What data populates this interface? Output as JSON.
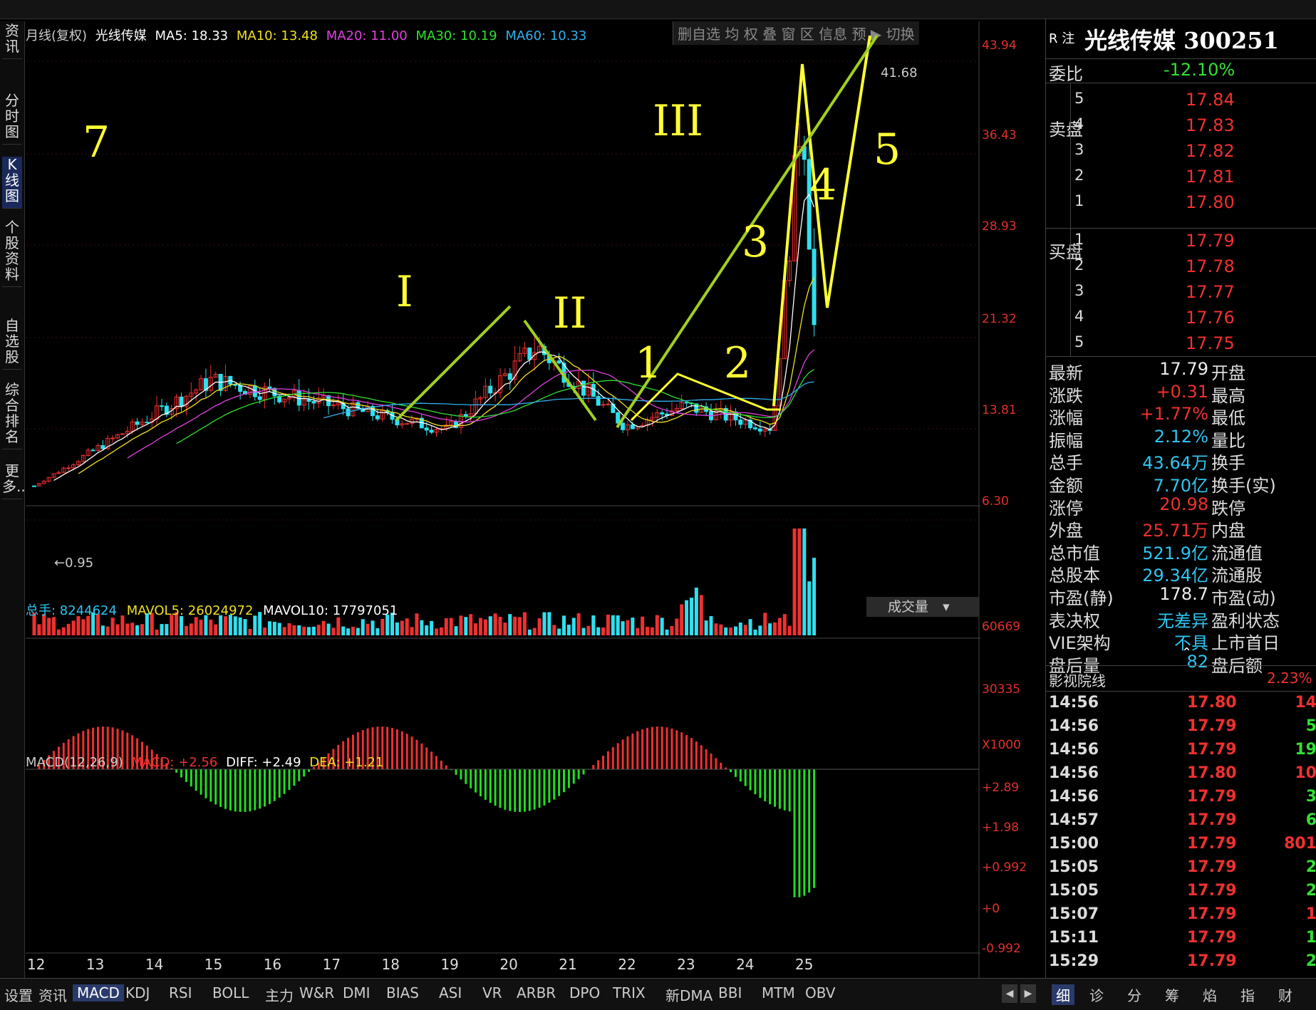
{
  "top_menu": [],
  "left_nav": [
    {
      "label": "资讯",
      "active": false
    },
    {
      "label": "分时图",
      "active": false
    },
    {
      "label": "K线图",
      "active": true
    },
    {
      "label": "个股资料",
      "active": false
    },
    {
      "label": "自选股",
      "active": false
    },
    {
      "label": "综合排名",
      "active": false
    },
    {
      "label": "更多..",
      "active": false
    }
  ],
  "chart_header": {
    "period": "月线(复权)",
    "stock_name": "光线传媒",
    "ma5": "MA5: 18.33",
    "ma10": "MA10: 13.48",
    "ma20": "MA20: 11.00",
    "ma30": "MA30: 10.19",
    "ma60": "MA60: 10.33",
    "tools": [
      "删自选",
      "均",
      "权",
      "叠",
      "窗",
      "区",
      "信息",
      "预",
      "切换"
    ]
  },
  "price_axis": [
    "43.94",
    "36.43",
    "28.93",
    "21.32",
    "13.81",
    "6.30"
  ],
  "price_annotations": {
    "high_label": "41.68",
    "low_label": "0.95"
  },
  "volume_header": {
    "total": "总手: 8244624",
    "mavol5": "MAVOL5: 26024972",
    "mavol10": "MAVOL10: 17797051",
    "selector": "成交量"
  },
  "volume_axis": [
    "60669",
    "30335",
    "X1000"
  ],
  "macd_header": {
    "name": "MACD(12,26,9)",
    "macd": "MACD: +2.56",
    "diff": "DIFF: +2.49",
    "dea": "DEA: +1.21"
  },
  "macd_axis": [
    "+2.89",
    "+1.98",
    "+0.992",
    "+0",
    "-0.992"
  ],
  "x_axis_labels": [
    "12",
    "13",
    "14",
    "15",
    "16",
    "17",
    "18",
    "19",
    "20",
    "21",
    "22",
    "23",
    "24",
    "25"
  ],
  "handwritten_marks": [
    "7",
    "I",
    "II",
    "III",
    "1",
    "2",
    "3",
    "4",
    "5"
  ],
  "chart_data": {
    "type": "candlestick",
    "ylim": [
      0,
      45
    ],
    "key_points": [
      {
        "x": "12",
        "close": 0.95
      },
      {
        "x": "15",
        "close": 12.0
      },
      {
        "x": "19",
        "close": 6.8
      },
      {
        "x": "20.5",
        "close": 15.5
      },
      {
        "x": "22",
        "close": 7.2
      },
      {
        "x": "23",
        "close": 9.3
      },
      {
        "x": "24.5",
        "close": 7.0
      },
      {
        "x": "25",
        "close": 41.68
      },
      {
        "x": "25.2",
        "close": 17.79
      }
    ]
  },
  "quote_panel": {
    "badge": "R 注",
    "title": "光线传媒 300251",
    "webi_label": "委比",
    "webi_value": "-12.10%",
    "sell_label": "卖盘",
    "buy_label": "买盘",
    "sell_levels": [
      {
        "n": "5",
        "price": "17.84"
      },
      {
        "n": "4",
        "price": "17.83"
      },
      {
        "n": "3",
        "price": "17.82"
      },
      {
        "n": "2",
        "price": "17.81"
      },
      {
        "n": "1",
        "price": "17.80"
      }
    ],
    "buy_levels": [
      {
        "n": "1",
        "price": "17.79"
      },
      {
        "n": "2",
        "price": "17.78"
      },
      {
        "n": "3",
        "price": "17.77"
      },
      {
        "n": "4",
        "price": "17.76"
      },
      {
        "n": "5",
        "price": "17.75"
      }
    ],
    "stats": [
      {
        "label": "最新",
        "value": "17.79",
        "label2": "开盘",
        "color": "wht"
      },
      {
        "label": "涨跌",
        "value": "+0.31",
        "label2": "最高",
        "color": "red"
      },
      {
        "label": "涨幅",
        "value": "+1.77%",
        "label2": "最低",
        "color": "red"
      },
      {
        "label": "振幅",
        "value": "2.12%",
        "label2": "量比",
        "color": "cyan"
      },
      {
        "label": "总手",
        "value": "43.64万",
        "label2": "换手",
        "color": "cyan"
      },
      {
        "label": "金额",
        "value": "7.70亿",
        "label2": "换手(实)",
        "color": "cyan"
      },
      {
        "label": "涨停",
        "value": "20.98",
        "label2": "跌停",
        "color": "red"
      },
      {
        "label": "外盘",
        "value": "25.71万",
        "label2": "内盘",
        "color": "red"
      },
      {
        "label": "总市值",
        "value": "521.9亿",
        "label2": "流通值",
        "color": "cyan"
      },
      {
        "label": "总股本",
        "value": "29.34亿",
        "label2": "流通股",
        "color": "cyan"
      },
      {
        "label": "市盈(静)",
        "value": "178.7",
        "label2": "市盈(动)",
        "color": "wht"
      },
      {
        "label": "表决权",
        "value": "无差异",
        "label2": "盈利状态",
        "color": "cyan"
      },
      {
        "label": "VIE架构",
        "value": "不具",
        "label2": "上市首日",
        "color": "cyan"
      },
      {
        "label": "盘后量",
        "value": "82",
        "label2": "盘后额",
        "color": "cyan"
      }
    ],
    "sector_name": "影视院线",
    "sector_change": "2.23%",
    "ticks": [
      {
        "time": "14:56",
        "price": "17.80",
        "vol": "14"
      },
      {
        "time": "14:56",
        "price": "17.79",
        "vol": "5"
      },
      {
        "time": "14:56",
        "price": "17.79",
        "vol": "19"
      },
      {
        "time": "14:56",
        "price": "17.80",
        "vol": "10"
      },
      {
        "time": "14:56",
        "price": "17.79",
        "vol": "3"
      },
      {
        "time": "14:57",
        "price": "17.79",
        "vol": "6"
      },
      {
        "time": "15:00",
        "price": "17.79",
        "vol": "801"
      },
      {
        "time": "15:05",
        "price": "17.79",
        "vol": "2"
      },
      {
        "time": "15:05",
        "price": "17.79",
        "vol": "2"
      },
      {
        "time": "15:07",
        "price": "17.79",
        "vol": "1"
      },
      {
        "time": "15:11",
        "price": "17.79",
        "vol": "1"
      },
      {
        "time": "15:29",
        "price": "17.79",
        "vol": "2"
      }
    ]
  },
  "bottom_tabs": [
    "设置",
    "资讯",
    "MACD",
    "KDJ",
    "RSI",
    "BOLL",
    "主力",
    "W&R",
    "DMI",
    "BIAS",
    "ASI",
    "VR",
    "ARBR",
    "DPO",
    "TRIX",
    "新DMA",
    "BBI",
    "MTM",
    "OBV"
  ],
  "bottom_tabs_active": "MACD",
  "right_tabs": [
    "细",
    "诊",
    "分",
    "筹",
    "焰",
    "指",
    "财"
  ],
  "colors": {
    "up": "#f03030",
    "down": "#2ee0f0",
    "ma5": "#ffffff",
    "ma10": "#f0e020",
    "ma20": "#e040e0",
    "ma30": "#30e030",
    "ma60": "#30b0f0",
    "annot_yellow": "#ffff33",
    "annot_green": "#a0d020"
  }
}
